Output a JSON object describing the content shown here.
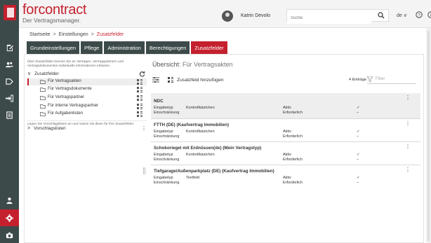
{
  "app": {
    "brand_name": "forcontract",
    "brand_subtitle": "Der Vertragsmanager."
  },
  "header": {
    "user_name": "Katrin Devolo",
    "search_placeholder": "Suche",
    "language": "de ∨"
  },
  "breadcrumb": {
    "items": [
      "Startseite",
      "Einstellungen",
      "Zusatzfelder"
    ],
    "separator": ">"
  },
  "tabs": [
    {
      "label": "Grundeinstellungen",
      "active": false
    },
    {
      "label": "Pflege",
      "active": false
    },
    {
      "label": "Administration",
      "active": false
    },
    {
      "label": "Berechtigungen",
      "active": false
    },
    {
      "label": "Zusatzfelder",
      "active": true
    }
  ],
  "left_panel": {
    "intro": "Über Zusatzfelder können Sie an Verträgen, Vertragspartnern und Vertragsdokumenten individuelle Informationen erfassen.",
    "root_label": "Zusatzfelder",
    "items": [
      {
        "label": "Für Vertragsakten",
        "selected": true
      },
      {
        "label": "Für Vertragsdokumente",
        "selected": false
      },
      {
        "label": "Für Vertragspartner",
        "selected": false
      },
      {
        "label": "Für interne Vertragspartner",
        "selected": false
      },
      {
        "label": "Für Aufgabenlisten",
        "selected": false
      }
    ],
    "note": "Legen Sie Vorschlagslisten an und nutzen Sie diese für Ihre Zusatzfelder.",
    "vorschlag_label": "Vorschlagslisten"
  },
  "right_panel": {
    "title_prefix": "Übersicht",
    "title_suffix": ": Für Vertragsakten",
    "add_label": "Zusatzfeld hinzufügen",
    "count_label": "4 Einträge",
    "filter_placeholder": "Filter",
    "fields": [
      {
        "name": "NDC",
        "typ_label": "Eingabetyp",
        "typ_value": "Kontrollkästchen",
        "einschraenkung_label": "Einschränkung",
        "aktiv_label": "Aktiv",
        "aktiv_value": "✓",
        "erforderlich_label": "Erforderlich",
        "erforderlich_value": "–"
      },
      {
        "name": "FTTH (DE) (Kaufvertrag Immobilien)",
        "typ_label": "Eingabetyp",
        "typ_value": "Kontrollkästchen",
        "einschraenkung_label": "Einschränkung",
        "aktiv_label": "Aktiv",
        "aktiv_value": "✓",
        "erforderlich_label": "Erforderlich",
        "erforderlich_value": "–"
      },
      {
        "name": "Schokoriegel mit Erdnüssen(de) (Mein Vertragstyp)",
        "typ_label": "Eingabetyp",
        "typ_value": "Kontrollkästchen",
        "einschraenkung_label": "Einschränkung",
        "aktiv_label": "Aktiv",
        "aktiv_value": "✓",
        "erforderlich_label": "Erforderlich",
        "erforderlich_value": "–"
      },
      {
        "name": "Tiefgarage/Außenparkplatz (DE) (Kaufvertrag Immobilien)",
        "typ_label": "Eingabetyp",
        "typ_value": "Textfeld",
        "einschraenkung_label": "Einschränkung",
        "aktiv_label": "Aktiv",
        "aktiv_value": "✓",
        "erforderlich_label": "Erforderlich",
        "erforderlich_value": "–"
      }
    ]
  },
  "colors": {
    "accent": "#c4202e",
    "rail": "#3d4a4a",
    "header_bg": "#f4f4f4"
  },
  "icons": {
    "rail_top": [
      "document-edit-icon",
      "users-icon",
      "tag-icon",
      "share-icon",
      "report-icon"
    ],
    "rail_bottom": [
      "person-icon",
      "settings-icon",
      "camera-icon"
    ],
    "header": [
      "search-icon",
      "help-icon",
      "info-icon",
      "logout-icon"
    ]
  }
}
